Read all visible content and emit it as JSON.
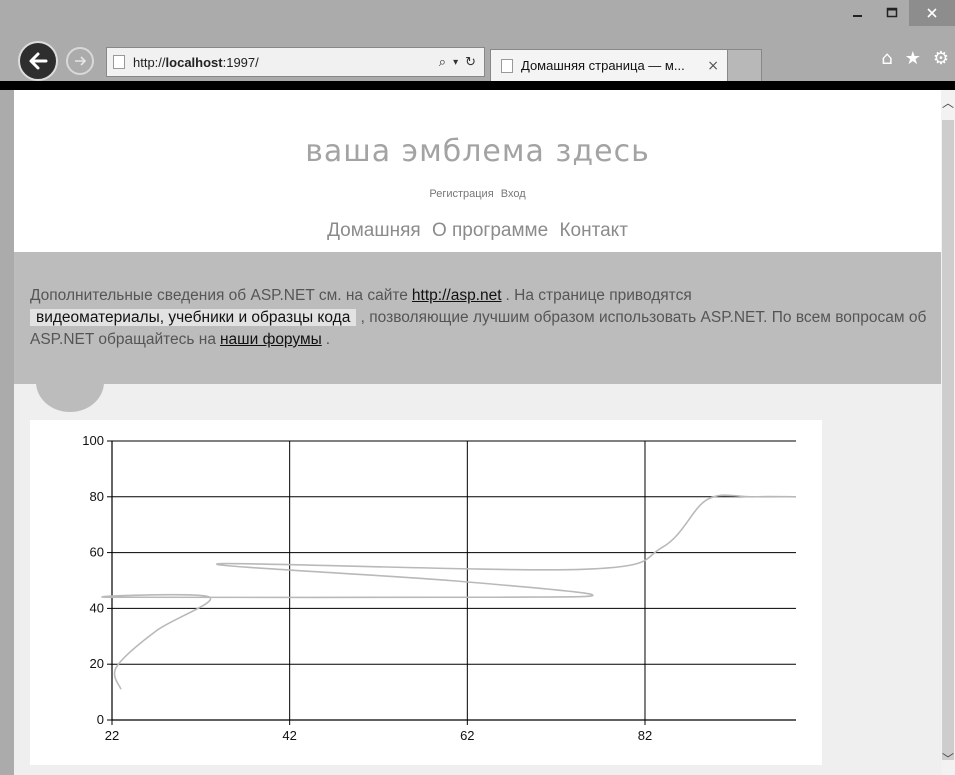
{
  "browser": {
    "url_prefix": "http://",
    "url_host": "localhost",
    "url_suffix": ":1997/",
    "tab_title": "Домашняя страница — м...",
    "search_glyph": "⌕",
    "dropdown_glyph": "▾",
    "refresh_glyph": "↻"
  },
  "site": {
    "logo": "ваша эмблема здесь",
    "login_links": [
      "Регистрация",
      "Вход"
    ],
    "menu": [
      "Домашняя",
      "О программе",
      "Контакт"
    ]
  },
  "featured": {
    "text1": "Дополнительные сведения об ASP.NET см. на сайте",
    "link1": "http://asp.net",
    "text2": ". На странице приводятся",
    "highlight": "видеоматериалы, учебники и образцы кода",
    "text3": ", позволяющие лучшим образом использовать ASP.NET. По всем вопросам об ASP.NET обращайтесь на",
    "link2": "наши форумы",
    "text4": "."
  },
  "colors": {
    "line": "#b9b9b9",
    "grid": "#000000",
    "page_bg": "#efefef",
    "featured_bg": "#bcbcbc"
  },
  "chart_data": {
    "type": "line",
    "x_ticks": [
      22,
      42,
      62,
      82
    ],
    "y_ticks": [
      0,
      20,
      40,
      60,
      80,
      100
    ],
    "xlim": [
      22,
      99
    ],
    "ylim": [
      0,
      100
    ],
    "grid": true,
    "series": [
      {
        "smooth": true,
        "points": [
          [
            23,
            11
          ],
          [
            22.5,
            19
          ],
          [
            27,
            32
          ],
          [
            33,
            44
          ],
          [
            22,
            44
          ],
          [
            65,
            44
          ],
          [
            76,
            45
          ],
          [
            60,
            50
          ],
          [
            34,
            56
          ],
          [
            75,
            54
          ],
          [
            84,
            62
          ],
          [
            89,
            79
          ],
          [
            94,
            80
          ],
          [
            99,
            80
          ]
        ]
      }
    ]
  }
}
